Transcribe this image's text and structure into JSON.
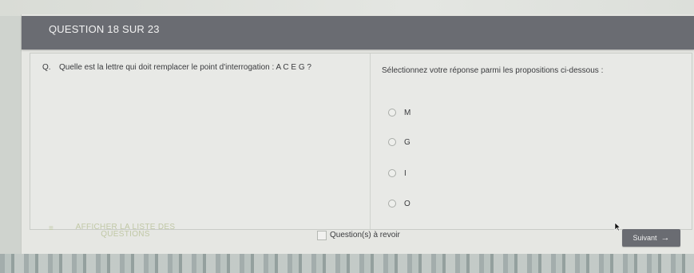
{
  "header": {
    "title": "QUESTION 18 SUR 23"
  },
  "question": {
    "letter": "Q.",
    "text": "Quelle est la lettre qui doit remplacer le point d'interrogation : A C E G ?"
  },
  "answers": {
    "instruction": "Sélectionnez votre réponse parmi les propositions ci-dessous :",
    "options": [
      "M",
      "G",
      "I",
      "O"
    ]
  },
  "footer": {
    "list_link": "AFFICHER LA LISTE DES QUESTIONS",
    "review_label": "Question(s) à revoir",
    "next_label": "Suivant",
    "next_arrow": "→"
  },
  "colors": {
    "header_bg": "#6a6c72",
    "button_bg": "#6a6c72",
    "link_color": "#c1c8a6"
  }
}
